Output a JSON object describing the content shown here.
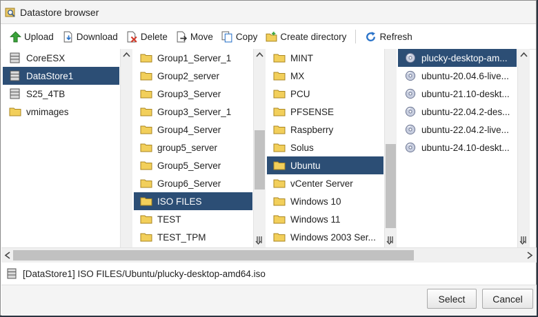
{
  "window": {
    "title": "Datastore browser"
  },
  "toolbar": {
    "upload": "Upload",
    "download": "Download",
    "delete": "Delete",
    "move": "Move",
    "copy": "Copy",
    "create_directory": "Create directory",
    "refresh": "Refresh"
  },
  "columns": {
    "datastores": [
      {
        "label": "CoreESX",
        "icon": "datastore-icon"
      },
      {
        "label": "DataStore1",
        "icon": "datastore-icon",
        "selected": true
      },
      {
        "label": "S25_4TB",
        "icon": "datastore-icon"
      },
      {
        "label": "vmimages",
        "icon": "folder-icon"
      }
    ],
    "folders1": [
      "Group1_Server_1",
      "Group2_server",
      "Group3_Server",
      "Group3_Server_1",
      "Group4_Server",
      "group5_server",
      "Group5_Server",
      "Group6_Server",
      "ISO FILES",
      "TEST",
      "TEST_TPM"
    ],
    "folders1_selected": "ISO FILES",
    "folders2": [
      "MINT",
      "MX",
      "PCU",
      "PFSENSE",
      "Raspberry",
      "Solus",
      "Ubuntu",
      "vCenter Server",
      "Windows 10",
      "Windows 11",
      "Windows 2003 Ser..."
    ],
    "folders2_selected": "Ubuntu",
    "files": [
      "plucky-desktop-am...",
      "ubuntu-20.04.6-live...",
      "ubuntu-21.10-deskt...",
      "ubuntu-22.04.2-des...",
      "ubuntu-22.04.2-live...",
      "ubuntu-24.10-deskt..."
    ],
    "files_selected": "plucky-desktop-am..."
  },
  "path": "[DataStore1] ISO FILES/Ubuntu/plucky-desktop-amd64.iso",
  "buttons": {
    "select": "Select",
    "cancel": "Cancel"
  },
  "colors": {
    "selection": "#2c4e75",
    "folder": "#f2cf5b",
    "upload": "#3aa23a",
    "delete": "#d23a2a",
    "refresh": "#2a73c9"
  }
}
